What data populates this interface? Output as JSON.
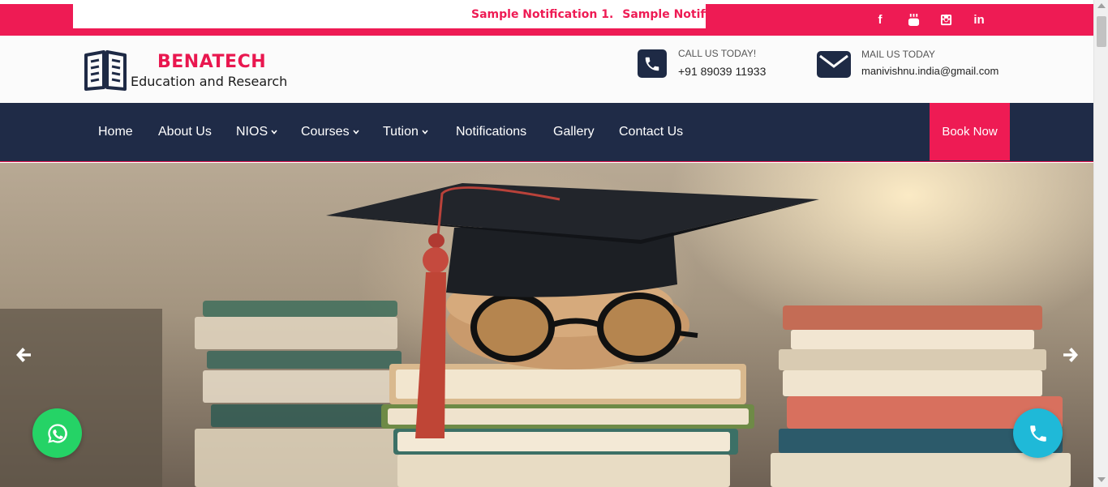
{
  "notification_bar": {
    "ticker_items": [
      "Sample Notification 1.",
      "Sample Notifica"
    ],
    "social": {
      "facebook": "f",
      "youtube_icon": "youtube-icon",
      "instagram_icon": "instagram-icon",
      "linkedin": "in"
    }
  },
  "header": {
    "brand": "BENATECH",
    "tagline": "Education and Research",
    "call": {
      "label": "CALL US TODAY!",
      "value": "+91 89039 11933"
    },
    "mail": {
      "label": "MAIL US TODAY",
      "value": "manivishnu.india@gmail.com"
    }
  },
  "nav": {
    "items": [
      {
        "label": "Home",
        "dropdown": false
      },
      {
        "label": "About Us",
        "dropdown": false
      },
      {
        "label": "NIOS",
        "dropdown": true
      },
      {
        "label": "Courses",
        "dropdown": true
      },
      {
        "label": "Tution",
        "dropdown": true
      },
      {
        "label": "Notifications",
        "dropdown": false
      },
      {
        "label": "Gallery",
        "dropdown": false
      },
      {
        "label": "Contact Us",
        "dropdown": false
      }
    ],
    "book_now": "Book Now"
  },
  "hero": {
    "prev_icon": "arrow-left-icon",
    "next_icon": "arrow-right-icon"
  },
  "floating": {
    "whatsapp_icon": "whatsapp-icon",
    "call_icon": "phone-icon"
  },
  "colors": {
    "accent": "#ee1b54",
    "navy": "#1f2b47",
    "whatsapp": "#25d366",
    "call": "#1fb9d8"
  }
}
